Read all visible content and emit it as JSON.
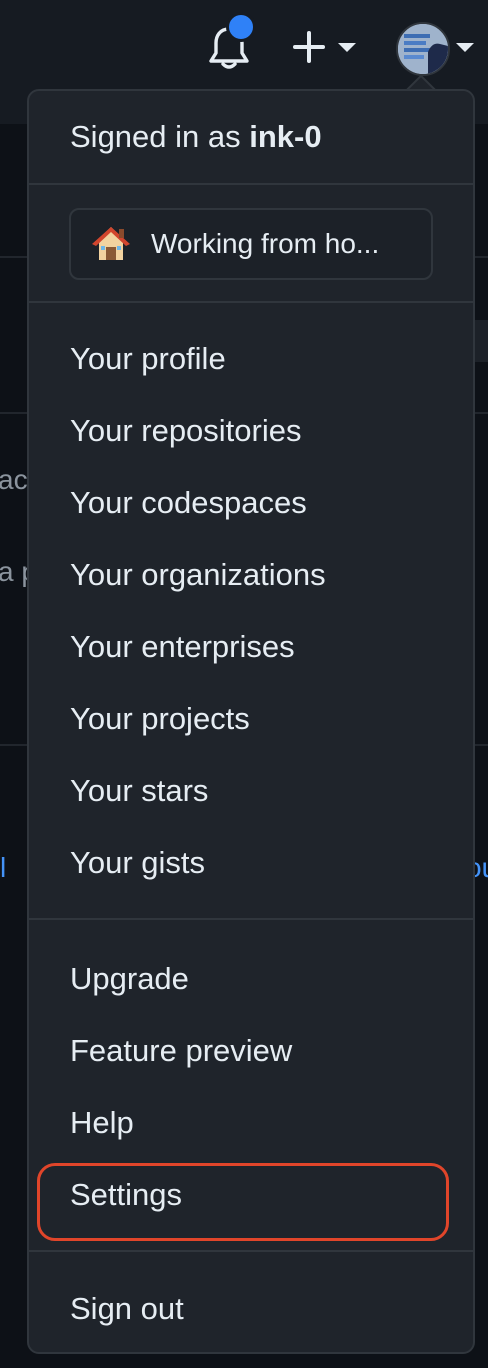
{
  "header": {
    "icons": [
      "bell-icon",
      "plus-icon",
      "chevron-down-icon",
      "avatar"
    ],
    "notification_dot_color": "#2f81f7"
  },
  "background": {
    "fragments": [
      "ac",
      "a p",
      "l",
      "ou"
    ]
  },
  "dropdown": {
    "signed_in_prefix": "Signed in as ",
    "username": "ink-0",
    "status": {
      "emoji": "house-icon",
      "text": "Working from ho..."
    },
    "group1": [
      "Your profile",
      "Your repositories",
      "Your codespaces",
      "Your organizations",
      "Your enterprises",
      "Your projects",
      "Your stars",
      "Your gists"
    ],
    "group2": [
      "Upgrade",
      "Feature preview",
      "Help",
      "Settings"
    ],
    "sign_out": "Sign out",
    "highlight_color": "#e0452a"
  }
}
